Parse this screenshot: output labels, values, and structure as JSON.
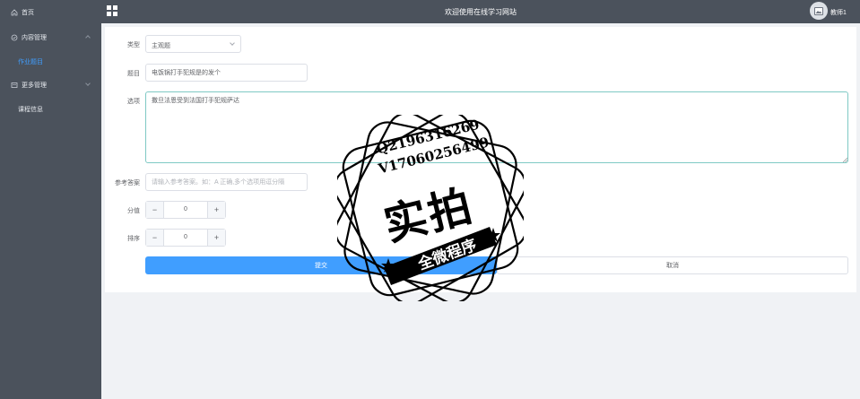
{
  "sidebar": {
    "items": [
      {
        "label": "首页",
        "icon": "home-icon"
      },
      {
        "label": "内容管理",
        "icon": "content-icon",
        "children": [
          {
            "label": "作业题目",
            "active": true
          }
        ]
      },
      {
        "label": "更多管理",
        "icon": "more-icon",
        "children": [
          {
            "label": "课程信息"
          }
        ]
      }
    ]
  },
  "header": {
    "title": "欢迎使用在线学习网站",
    "user": "教师1",
    "menu_icon": "grid-icon",
    "avatar_icon": "image-icon"
  },
  "form": {
    "type": {
      "label": "类型",
      "value": "主观题"
    },
    "question": {
      "label": "题目",
      "value": "电饭锅打手犯规是的发个"
    },
    "options": {
      "label": "选项",
      "value": "撒旦法恩受到法国打手犯规萨达"
    },
    "answer": {
      "label": "参考答案",
      "placeholder": "请输入参考答案。如：A 正确,多个选项用逗分隔",
      "value": ""
    },
    "score": {
      "label": "分值",
      "value": "0"
    },
    "order": {
      "label": "排序",
      "value": "0"
    },
    "submit_label": "提交",
    "cancel_label": "取消"
  },
  "watermark": {
    "line1": "Q2196316269",
    "line2": "V17060256499",
    "main": "实拍",
    "banner": "全微程序"
  },
  "colors": {
    "sidebar_bg": "#4b525c",
    "header_bg": "#4b525c",
    "active": "#409eff",
    "primary": "#409eff"
  }
}
